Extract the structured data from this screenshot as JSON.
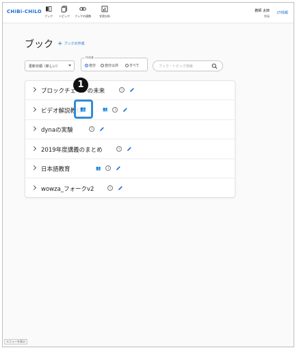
{
  "header": {
    "logo": "CHiBi-CHiLO",
    "nav": [
      {
        "label": "ブック",
        "icon": "book-icon"
      },
      {
        "label": "トピック",
        "icon": "topic-icon"
      },
      {
        "label": "ブックの連携",
        "icon": "link-icon"
      },
      {
        "label": "学習分析",
        "icon": "analytics-icon"
      }
    ],
    "user_name": "教師 太郎",
    "user_role": "教員",
    "lti_label": "LTI情報"
  },
  "page": {
    "title": "ブック",
    "create_label": "ブックの作成"
  },
  "filters": {
    "sort_value": "更新日順（新しい）",
    "creator_legend": "作成者",
    "creator_options": [
      "自分",
      "自分以外",
      "すべて"
    ],
    "creator_selected": "自分",
    "search_placeholder": "ブック・トピック検索"
  },
  "books": [
    {
      "name": "ブロックチェーンの未来",
      "shared": false
    },
    {
      "name": "ビデオ解説教材",
      "shared": true
    },
    {
      "name": "dynaの実験",
      "shared": false
    },
    {
      "name": "2019年度講義のまとめ",
      "shared": false
    },
    {
      "name": "日本語教育",
      "shared": true
    },
    {
      "name": "wowza_フォークv2",
      "shared": false
    }
  ],
  "annotation": {
    "number": "1"
  },
  "footer": {
    "menu_label": "メニューを表示"
  },
  "colors": {
    "accent": "#1e6fd1",
    "highlight": "#2f8bd8"
  }
}
